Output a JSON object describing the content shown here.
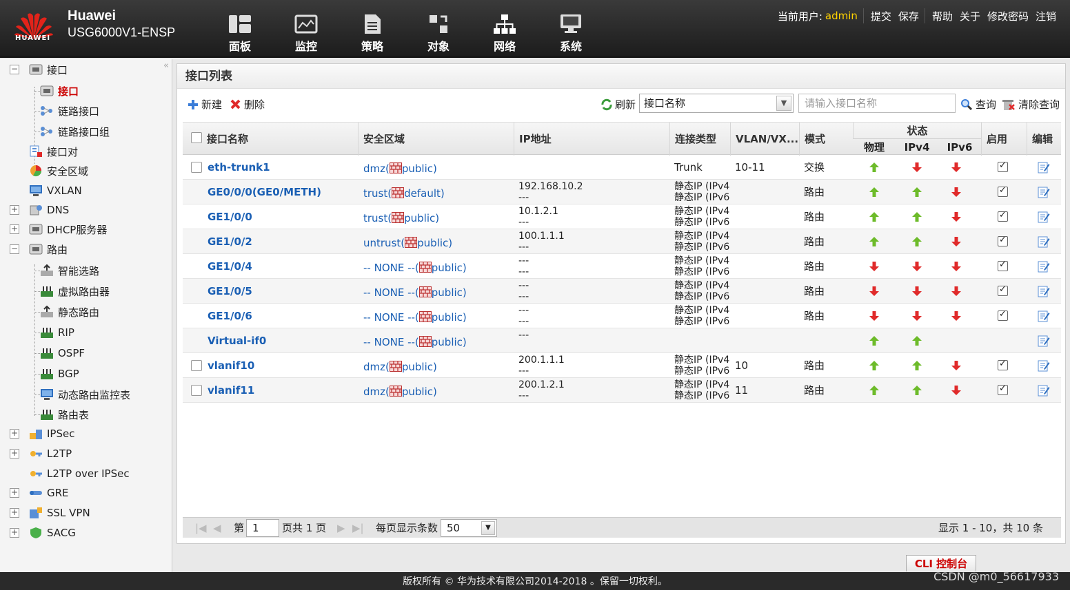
{
  "header": {
    "brand_name": "Huawei",
    "product": "USG6000V1-ENSP",
    "logo_text": "HUAWEI",
    "nav": [
      {
        "label": "面板",
        "icon": "dashboard-icon"
      },
      {
        "label": "监控",
        "icon": "monitor-icon"
      },
      {
        "label": "策略",
        "icon": "policy-icon"
      },
      {
        "label": "对象",
        "icon": "object-icon"
      },
      {
        "label": "网络",
        "icon": "network-icon"
      },
      {
        "label": "系统",
        "icon": "system-icon"
      }
    ],
    "current_user_label": "当前用户:",
    "current_user": "admin",
    "links": [
      "提交",
      "保存",
      "帮助",
      "关于",
      "修改密码",
      "注销"
    ]
  },
  "sidebar": {
    "items": [
      {
        "label": "接口"
      },
      {
        "label": "接口"
      },
      {
        "label": "链路接口"
      },
      {
        "label": "链路接口组"
      },
      {
        "label": "接口对"
      },
      {
        "label": "安全区域"
      },
      {
        "label": "VXLAN"
      },
      {
        "label": "DNS"
      },
      {
        "label": "DHCP服务器"
      },
      {
        "label": "路由"
      },
      {
        "label": "智能选路"
      },
      {
        "label": "虚拟路由器"
      },
      {
        "label": "静态路由"
      },
      {
        "label": "RIP"
      },
      {
        "label": "OSPF"
      },
      {
        "label": "BGP"
      },
      {
        "label": "动态路由监控表"
      },
      {
        "label": "路由表"
      },
      {
        "label": "IPSec"
      },
      {
        "label": "L2TP"
      },
      {
        "label": "L2TP over IPSec"
      },
      {
        "label": "GRE"
      },
      {
        "label": "SSL VPN"
      },
      {
        "label": "SACG"
      }
    ]
  },
  "panel": {
    "title": "接口列表",
    "new_label": "新建",
    "delete_label": "删除",
    "refresh_label": "刷新",
    "filter_select": "接口名称",
    "search_placeholder": "请输入接口名称",
    "query_label": "查询",
    "clear_label": "清除查询"
  },
  "table": {
    "columns": {
      "name": "接口名称",
      "zone": "安全区域",
      "ip": "IP地址",
      "conn": "连接类型",
      "vlan": "VLAN/VX...",
      "mode": "模式",
      "status": "状态",
      "phy": "物理",
      "ipv4": "IPv4",
      "ipv6": "IPv6",
      "enable": "启用",
      "edit": "编辑"
    },
    "rows": [
      {
        "name": "eth-trunk1",
        "zone_pre": "dmz(",
        "zone_post": "public)",
        "ip1": "",
        "ip2": "",
        "conn1": "Trunk",
        "conn2": "",
        "vlan": "10-11",
        "mode": "交换",
        "phy": "up",
        "ipv4": "down",
        "ipv6": "down"
      },
      {
        "name": "GE0/0/0(GE0/METH)",
        "zone_pre": "trust(",
        "zone_post": "default)",
        "ip1": "192.168.10.2",
        "ip2": "---",
        "conn1": "静态IP (IPv4",
        "conn2": "静态IP (IPv6",
        "vlan": "",
        "mode": "路由",
        "phy": "up",
        "ipv4": "up",
        "ipv6": "down"
      },
      {
        "name": "GE1/0/0",
        "zone_pre": "trust(",
        "zone_post": "public)",
        "ip1": "10.1.2.1",
        "ip2": "---",
        "conn1": "静态IP (IPv4",
        "conn2": "静态IP (IPv6",
        "vlan": "",
        "mode": "路由",
        "phy": "up",
        "ipv4": "up",
        "ipv6": "down"
      },
      {
        "name": "GE1/0/2",
        "zone_pre": "untrust(",
        "zone_post": "public)",
        "ip1": "100.1.1.1",
        "ip2": "---",
        "conn1": "静态IP (IPv4",
        "conn2": "静态IP (IPv6",
        "vlan": "",
        "mode": "路由",
        "phy": "up",
        "ipv4": "up",
        "ipv6": "down"
      },
      {
        "name": "GE1/0/4",
        "zone_pre": "-- NONE --(",
        "zone_post": "public)",
        "ip1": "---",
        "ip2": "---",
        "conn1": "静态IP (IPv4",
        "conn2": "静态IP (IPv6",
        "vlan": "",
        "mode": "路由",
        "phy": "down",
        "ipv4": "down",
        "ipv6": "down"
      },
      {
        "name": "GE1/0/5",
        "zone_pre": "-- NONE --(",
        "zone_post": "public)",
        "ip1": "---",
        "ip2": "---",
        "conn1": "静态IP (IPv4",
        "conn2": "静态IP (IPv6",
        "vlan": "",
        "mode": "路由",
        "phy": "down",
        "ipv4": "down",
        "ipv6": "down"
      },
      {
        "name": "GE1/0/6",
        "zone_pre": "-- NONE --(",
        "zone_post": "public)",
        "ip1": "---",
        "ip2": "---",
        "conn1": "静态IP (IPv4",
        "conn2": "静态IP (IPv6",
        "vlan": "",
        "mode": "路由",
        "phy": "down",
        "ipv4": "down",
        "ipv6": "down"
      },
      {
        "name": "Virtual-if0",
        "zone_pre": "-- NONE --(",
        "zone_post": "public)",
        "ip1": "---",
        "ip2": "",
        "conn1": "",
        "conn2": "",
        "vlan": "",
        "mode": "",
        "phy": "up",
        "ipv4": "up",
        "ipv6": ""
      },
      {
        "name": "vlanif10",
        "zone_pre": "dmz(",
        "zone_post": "public)",
        "ip1": "200.1.1.1",
        "ip2": "---",
        "conn1": "静态IP (IPv4",
        "conn2": "静态IP (IPv6",
        "vlan": "10",
        "mode": "路由",
        "phy": "up",
        "ipv4": "up",
        "ipv6": "down"
      },
      {
        "name": "vlanif11",
        "zone_pre": "dmz(",
        "zone_post": "public)",
        "ip1": "200.1.2.1",
        "ip2": "---",
        "conn1": "静态IP (IPv4",
        "conn2": "静态IP (IPv6",
        "vlan": "11",
        "mode": "路由",
        "phy": "up",
        "ipv4": "up",
        "ipv6": "down"
      }
    ]
  },
  "pager": {
    "page_prefix": "第",
    "page_value": "1",
    "page_suffix": "页共 1 页",
    "per_page_label": "每页显示条数",
    "per_page_value": "50",
    "summary": "显示 1 - 10，共 10 条"
  },
  "cli_label": "CLI 控制台",
  "footer": "版权所有 © 华为技术有限公司2014-2018 。保留一切权利。",
  "watermark": "CSDN @m0_56617933",
  "colors": {
    "up": "#6dbb2a",
    "down": "#e02a2a",
    "link": "#1a5fb4",
    "active": "#cc0000"
  }
}
